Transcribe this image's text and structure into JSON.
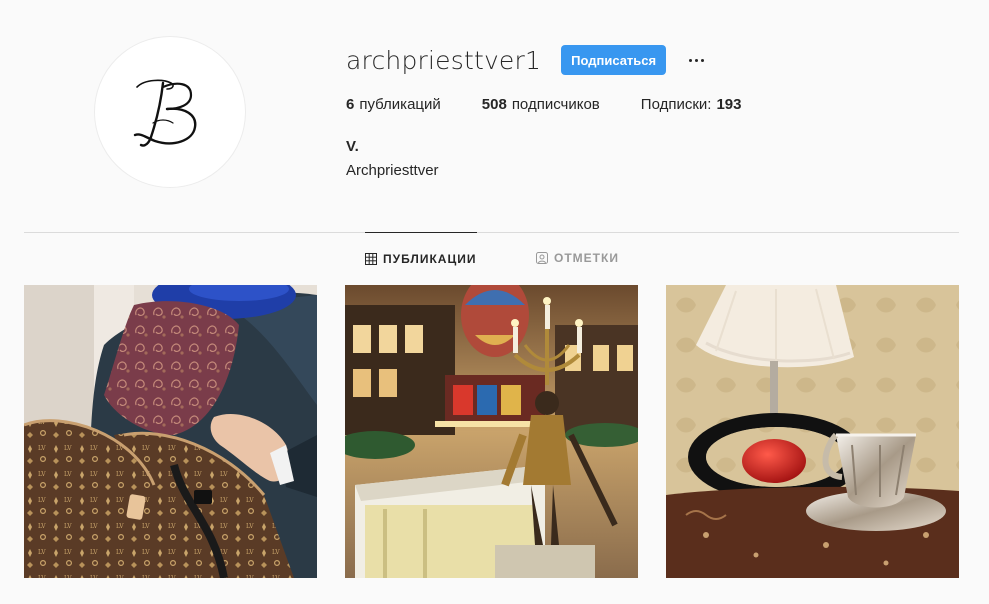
{
  "profile": {
    "username": "archpriesttver1",
    "follow_label": "Подписаться",
    "avatar_letter": "B",
    "full_name": "V.",
    "bio": "Archpriesttver"
  },
  "stats": {
    "posts_count": "6",
    "posts_label": "публикаций",
    "followers_count": "508",
    "followers_label": "подписчиков",
    "following_label": "Подписки:",
    "following_count": "193"
  },
  "tabs": [
    {
      "label": "ПУБЛИКАЦИИ",
      "icon": "grid-icon",
      "active": true
    },
    {
      "label": "ОТМЕТКИ",
      "icon": "tag-icon",
      "active": false
    }
  ],
  "posts": [
    {
      "subject": "handbag-scarf-photo"
    },
    {
      "subject": "mall-candelabra-photo"
    },
    {
      "subject": "lamp-teacup-photo"
    }
  ],
  "colors": {
    "accent": "#3897f0",
    "background": "#fafafa",
    "text": "#262626",
    "muted": "#999999"
  }
}
